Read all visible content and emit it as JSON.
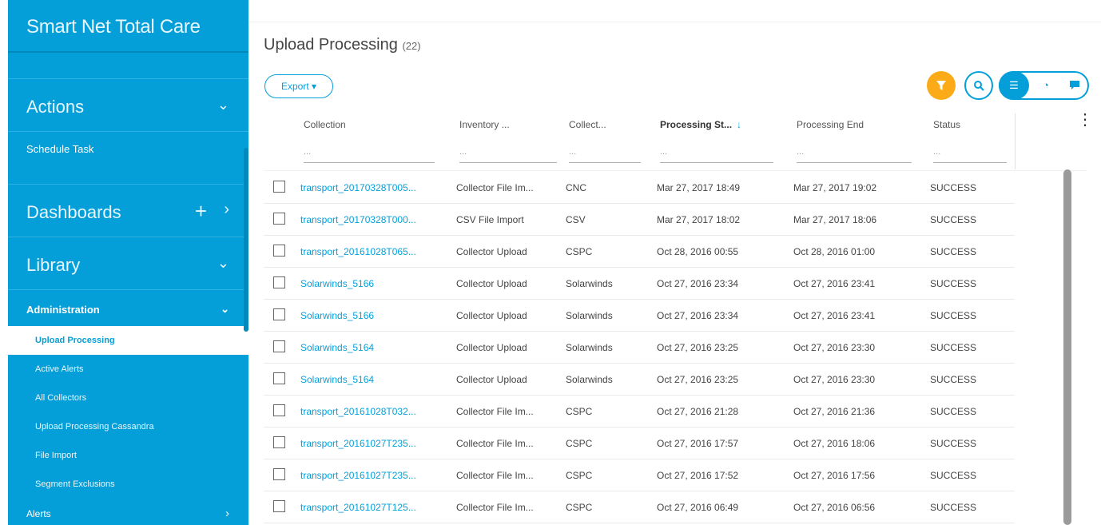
{
  "sidebar": {
    "brand": "Smart Net Total Care",
    "sections": {
      "actions": "Actions",
      "schedule_task": "Schedule Task",
      "dashboards": "Dashboards",
      "library": "Library",
      "administration": "Administration",
      "alerts": "Alerts"
    },
    "admin_items": [
      "Upload Processing",
      "Active Alerts",
      "All Collectors",
      "Upload Processing Cassandra",
      "File Import",
      "Segment Exclusions"
    ],
    "icons": {
      "chevron": "chevron-down-icon",
      "plus": "plus-icon",
      "arrow": "chevron-right-icon"
    }
  },
  "main": {
    "title": "Upload Processing",
    "count": "(22)",
    "export_label": "Export",
    "toolbar_icons": [
      "filter-icon",
      "search-icon",
      "list-view-icon",
      "pie-view-icon",
      "chat-view-icon"
    ],
    "colors": {
      "accent": "#049fd9",
      "filter": "#fbab18"
    }
  },
  "table": {
    "columns": [
      "Collection",
      "Inventory ...",
      "Collect...",
      "Processing St...",
      "Processing End",
      "Status"
    ],
    "filter_placeholder": "...",
    "sorted_column": "Processing St...",
    "sort_direction": "desc",
    "rows": [
      [
        "transport_20170328T005...",
        "Collector File Im...",
        "CNC",
        "Mar 27, 2017 18:49",
        "Mar 27, 2017 19:02",
        "SUCCESS"
      ],
      [
        "transport_20170328T000...",
        "CSV File Import",
        "CSV",
        "Mar 27, 2017 18:02",
        "Mar 27, 2017 18:06",
        "SUCCESS"
      ],
      [
        "transport_20161028T065...",
        "Collector Upload",
        "CSPC",
        "Oct 28, 2016 00:55",
        "Oct 28, 2016 01:00",
        "SUCCESS"
      ],
      [
        "Solarwinds_5166",
        "Collector Upload",
        "Solarwinds",
        "Oct 27, 2016 23:34",
        "Oct 27, 2016 23:41",
        "SUCCESS"
      ],
      [
        "Solarwinds_5166",
        "Collector Upload",
        "Solarwinds",
        "Oct 27, 2016 23:34",
        "Oct 27, 2016 23:41",
        "SUCCESS"
      ],
      [
        "Solarwinds_5164",
        "Collector Upload",
        "Solarwinds",
        "Oct 27, 2016 23:25",
        "Oct 27, 2016 23:30",
        "SUCCESS"
      ],
      [
        "Solarwinds_5164",
        "Collector Upload",
        "Solarwinds",
        "Oct 27, 2016 23:25",
        "Oct 27, 2016 23:30",
        "SUCCESS"
      ],
      [
        "transport_20161028T032...",
        "Collector File Im...",
        "CSPC",
        "Oct 27, 2016 21:28",
        "Oct 27, 2016 21:36",
        "SUCCESS"
      ],
      [
        "transport_20161027T235...",
        "Collector File Im...",
        "CSPC",
        "Oct 27, 2016 17:57",
        "Oct 27, 2016 18:06",
        "SUCCESS"
      ],
      [
        "transport_20161027T235...",
        "Collector File Im...",
        "CSPC",
        "Oct 27, 2016 17:52",
        "Oct 27, 2016 17:56",
        "SUCCESS"
      ],
      [
        "transport_20161027T125...",
        "Collector File Im...",
        "CSPC",
        "Oct 27, 2016 06:49",
        "Oct 27, 2016 06:56",
        "SUCCESS"
      ]
    ]
  }
}
